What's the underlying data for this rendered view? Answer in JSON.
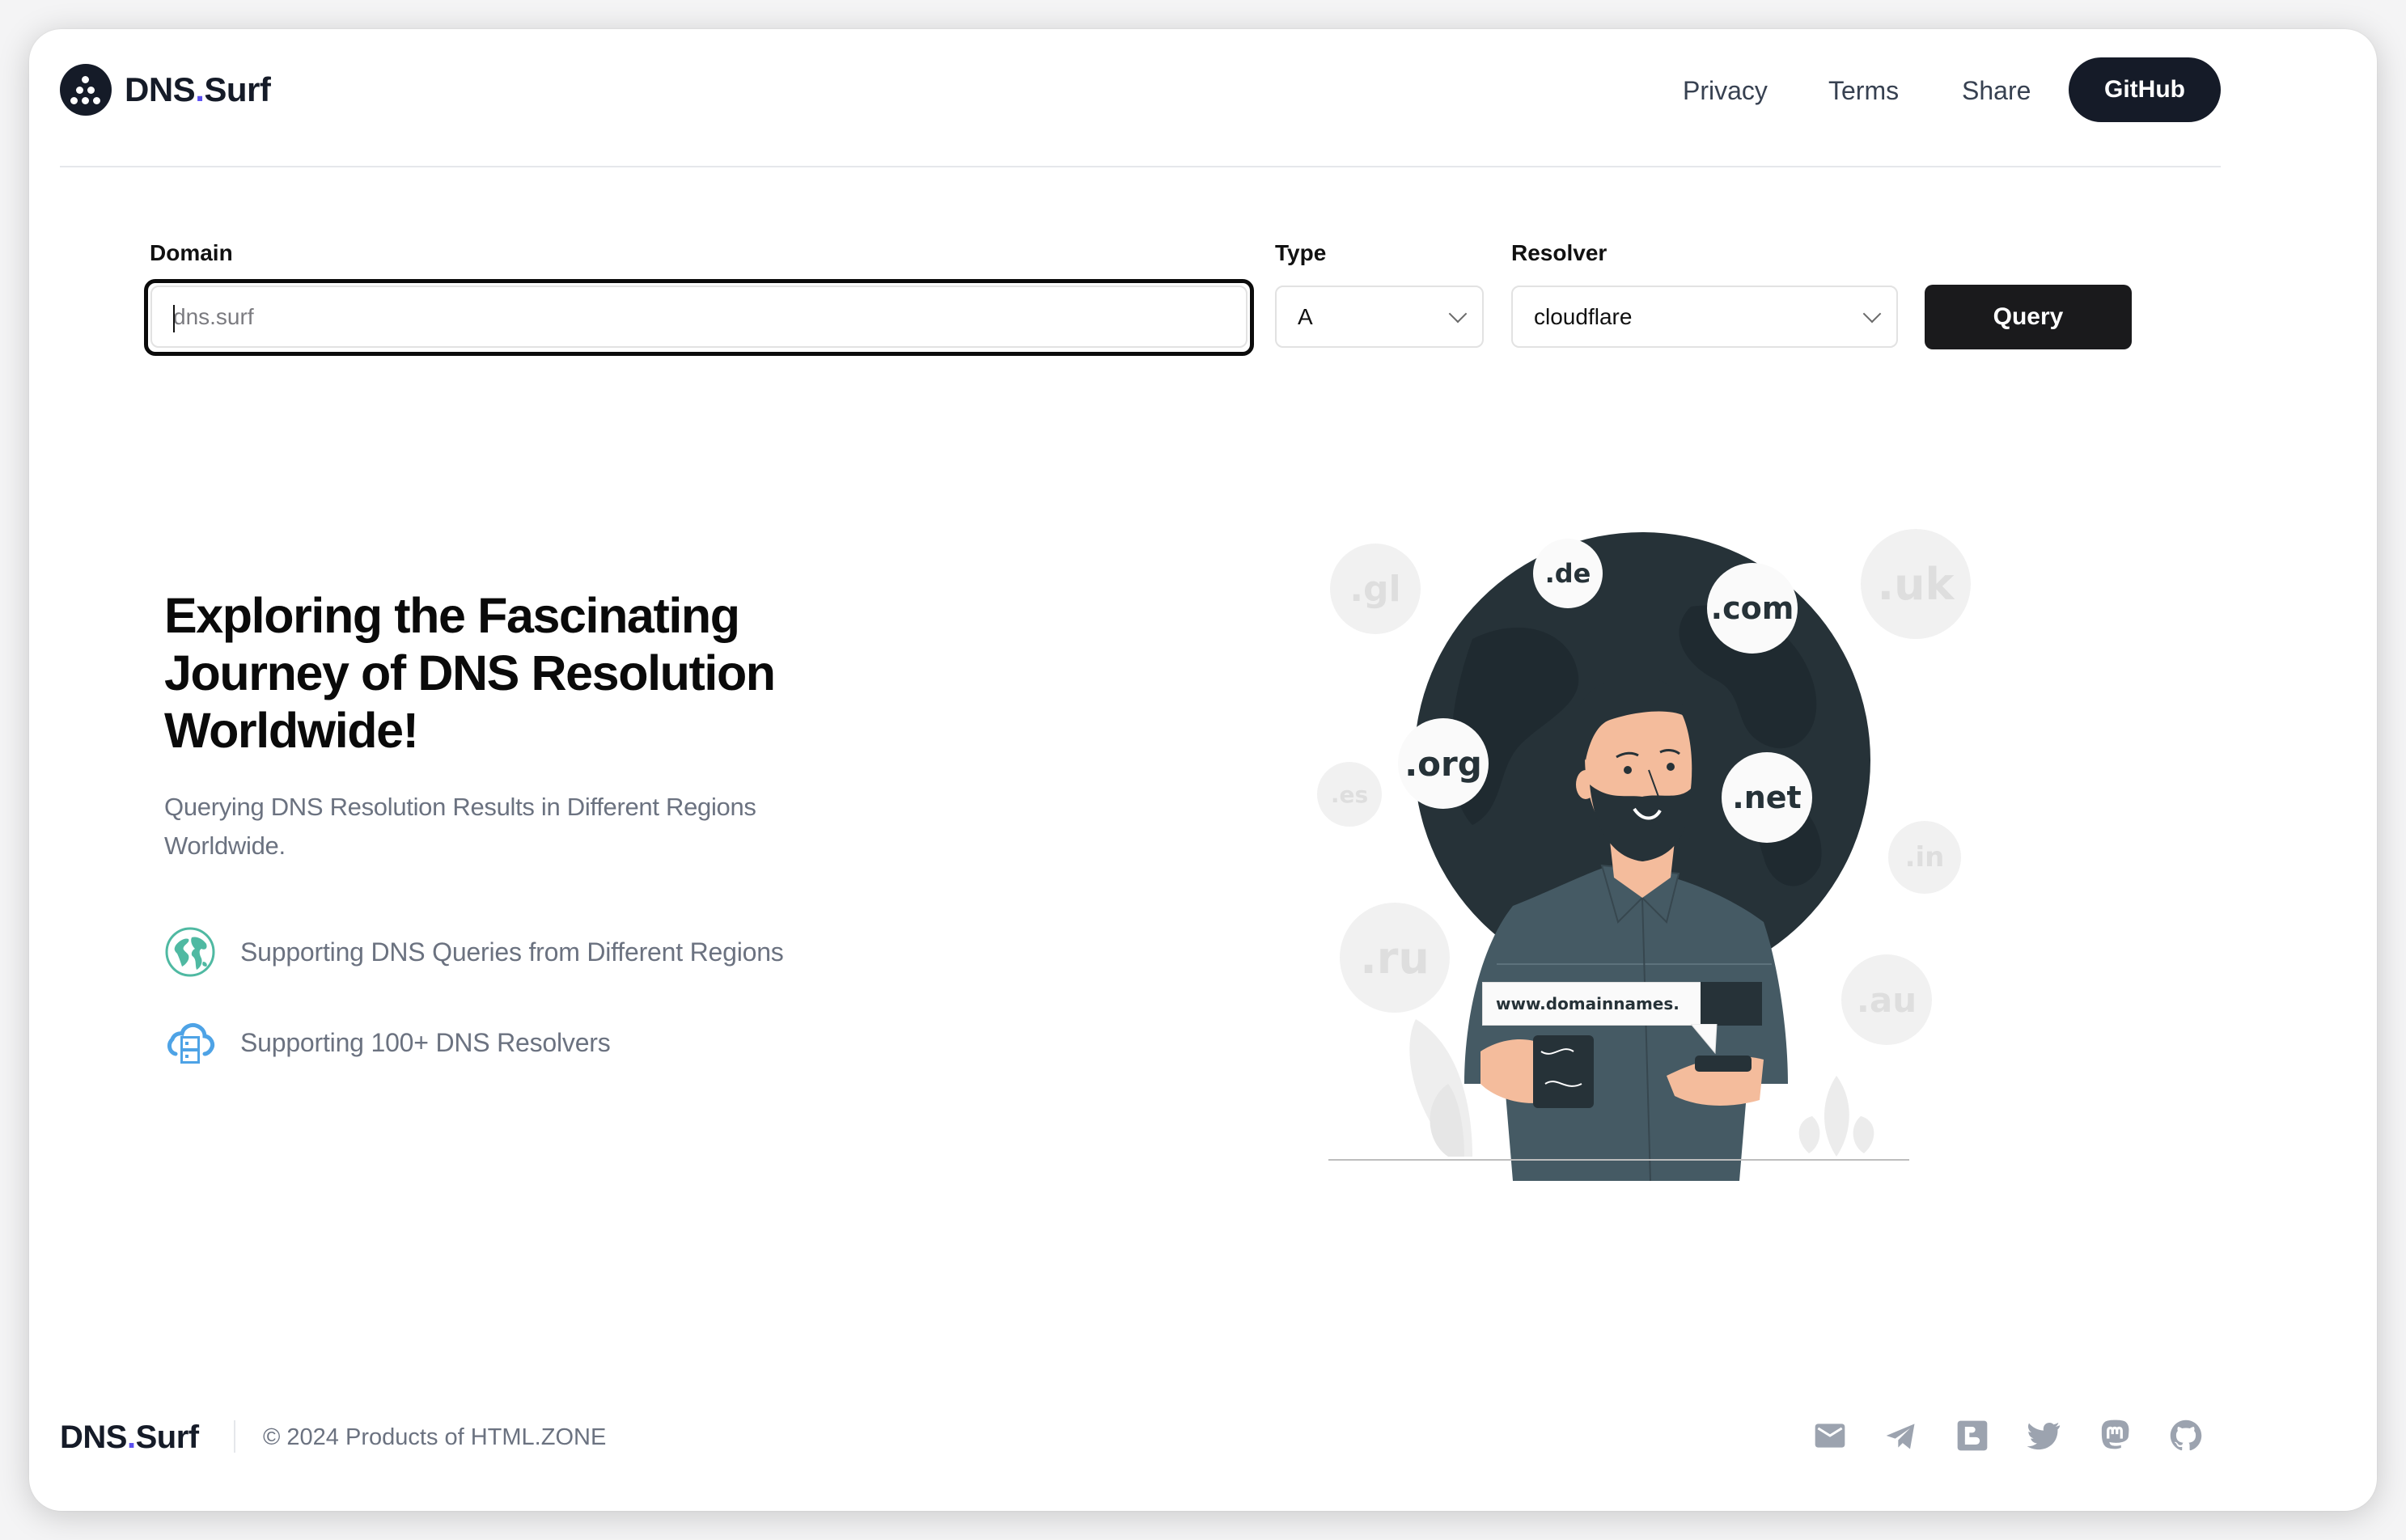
{
  "header": {
    "brand_name": "DNS",
    "brand_dot": ".",
    "brand_suffix": "Surf",
    "nav": [
      {
        "label": "Privacy"
      },
      {
        "label": "Terms"
      },
      {
        "label": "Share"
      }
    ],
    "github_label": "GitHub"
  },
  "form": {
    "domain_label": "Domain",
    "domain_value": "",
    "domain_placeholder": "dns.surf",
    "type_label": "Type",
    "type_value": "A",
    "resolver_label": "Resolver",
    "resolver_value": "cloudflare",
    "query_label": "Query"
  },
  "hero": {
    "title": "Exploring the Fascinating Journey of DNS Resolution Worldwide!",
    "subtitle": "Querying DNS Resolution Results in Different Regions Worldwide.",
    "features": [
      {
        "icon": "globe-icon",
        "text": "Supporting DNS Queries from Different Regions"
      },
      {
        "icon": "cloud-server-icon",
        "text": "Supporting 100+ DNS Resolvers"
      }
    ]
  },
  "illustration": {
    "tlds_foreground": [
      ".de",
      ".com",
      ".org",
      ".net"
    ],
    "tlds_background": [
      ".gl",
      ".uk",
      ".es",
      ".in",
      ".ru",
      ".au"
    ],
    "address_bar_text": "www.domainnames."
  },
  "footer": {
    "brand_name": "DNS",
    "brand_dot": ".",
    "brand_suffix": "Surf",
    "copyright": "© 2024 Products of HTML.ZONE",
    "social": [
      "mail-icon",
      "telegram-icon",
      "blogger-icon",
      "twitter-icon",
      "mastodon-icon",
      "github-icon"
    ]
  },
  "colors": {
    "brand_dark": "#151b28",
    "brand_dot": "#5b4ff0",
    "globe_icon": "#4fb9a2",
    "cloud_icon": "#4ea3e6",
    "muted_text": "#6b7280",
    "social_icon": "#9ca3af"
  }
}
